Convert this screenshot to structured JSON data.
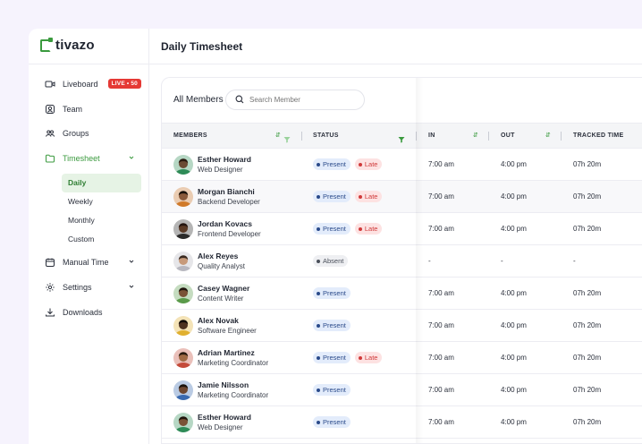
{
  "brand": {
    "name": "tivazo",
    "accent": "#3a9a3e"
  },
  "header": {
    "title": "Daily Timesheet"
  },
  "sidebar": {
    "items": [
      {
        "label": "Liveboard",
        "icon": "video-icon",
        "badge": "LIVE • 50"
      },
      {
        "label": "Team",
        "icon": "user-icon"
      },
      {
        "label": "Groups",
        "icon": "users-icon"
      },
      {
        "label": "Timesheet",
        "icon": "folder-icon",
        "active": true,
        "expanded": true
      },
      {
        "label": "Manual Time",
        "icon": "calendar-icon"
      },
      {
        "label": "Settings",
        "icon": "gear-icon"
      },
      {
        "label": "Downloads",
        "icon": "download-icon"
      }
    ],
    "timesheet_sub": [
      "Daily",
      "Weekly",
      "Monthly",
      "Custom"
    ]
  },
  "toolbar": {
    "label": "All Members",
    "search_placeholder": "Search Member"
  },
  "table": {
    "columns": [
      "MEMBERS",
      "STATUS",
      "IN",
      "OUT",
      "TRACKED TIME"
    ],
    "rows": [
      {
        "name": "Esther Howard",
        "role": "Web Designer",
        "status": [
          "Present",
          "Late"
        ],
        "in": "7:00 am",
        "out": "4:00 pm",
        "tracked": "07h 20m"
      },
      {
        "name": "Morgan Bianchi",
        "role": "Backend Developer",
        "status": [
          "Present",
          "Late"
        ],
        "in": "7:00 am",
        "out": "4:00 pm",
        "tracked": "07h 20m"
      },
      {
        "name": "Jordan Kovacs",
        "role": "Frontend Developer",
        "status": [
          "Present",
          "Late"
        ],
        "in": "7:00 am",
        "out": "4:00 pm",
        "tracked": "07h 20m"
      },
      {
        "name": "Alex Reyes",
        "role": "Quality Analyst",
        "status": [
          "Absent"
        ],
        "in": "-",
        "out": "-",
        "tracked": "-"
      },
      {
        "name": "Casey Wagner",
        "role": "Content Writer",
        "status": [
          "Present"
        ],
        "in": "7:00 am",
        "out": "4:00 pm",
        "tracked": "07h 20m"
      },
      {
        "name": "Alex Novak",
        "role": "Software Engineer",
        "status": [
          "Present"
        ],
        "in": "7:00 am",
        "out": "4:00 pm",
        "tracked": "07h 20m"
      },
      {
        "name": "Adrian Martinez",
        "role": "Marketing Coordinator",
        "status": [
          "Present",
          "Late"
        ],
        "in": "7:00 am",
        "out": "4:00 pm",
        "tracked": "07h 20m"
      },
      {
        "name": "Jamie Nilsson",
        "role": "Marketing Coordinator",
        "status": [
          "Present"
        ],
        "in": "7:00 am",
        "out": "4:00 pm",
        "tracked": "07h 20m"
      },
      {
        "name": "Esther Howard",
        "role": "Web Designer",
        "status": [
          "Present"
        ],
        "in": "7:00 am",
        "out": "4:00 pm",
        "tracked": "07h 20m"
      }
    ]
  }
}
